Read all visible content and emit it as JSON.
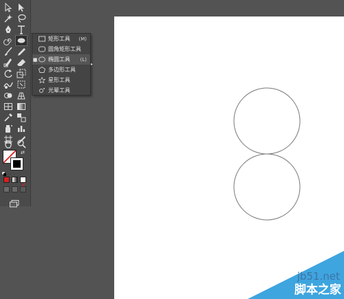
{
  "flyout": {
    "items": [
      {
        "label": "矩形工具",
        "shortcut": "(M)",
        "icon": "rectangle-icon"
      },
      {
        "label": "圆角矩形工具",
        "shortcut": "",
        "icon": "rounded-rectangle-icon"
      },
      {
        "label": "椭圆工具",
        "shortcut": "(L)",
        "icon": "ellipse-icon",
        "selected": true
      },
      {
        "label": "多边形工具",
        "shortcut": "",
        "icon": "polygon-icon"
      },
      {
        "label": "星形工具",
        "shortcut": "",
        "icon": "star-icon"
      },
      {
        "label": "光晕工具",
        "shortcut": "",
        "icon": "flare-icon"
      }
    ]
  },
  "watermark": {
    "url": "jb51.net",
    "name": "脚本之家",
    "color": "#3ea5df"
  },
  "colors": {
    "workspace": "#535353",
    "toolbar": "#4a4a4a",
    "artboard": "#ffffff",
    "circle_stroke": "#777777"
  }
}
